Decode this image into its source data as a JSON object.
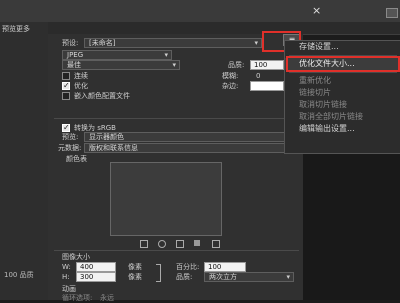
{
  "app": {
    "close_glyph": "×",
    "preview_tab": "预览更多"
  },
  "settings": {
    "preset_label": "预设:",
    "preset_value": "[未命名]",
    "format_value": "JPEG",
    "quality_level": "最佳",
    "quality_label": "品质:",
    "quality_value": "100",
    "progressive_label": "连续",
    "optimize_label": "优化",
    "embed_profile_label": "嵌入颜色配置文件",
    "blur_label": "模糊:",
    "blur_value": "0",
    "matte_label": "杂边:",
    "convert_srgb_label": "转换为 sRGB",
    "preview_label": "预览:",
    "preview_value": "显示器颜色",
    "metadata_label": "元数据:",
    "metadata_value": "版权和联系信息",
    "color_table_label": "颜色表"
  },
  "menu": {
    "button_glyph": "≡",
    "items": [
      {
        "label": "存储设置...",
        "state": "normal"
      },
      {
        "label": "",
        "state": "separator"
      },
      {
        "label": "优化文件大小...",
        "state": "highlighted"
      },
      {
        "label": "",
        "state": "separator"
      },
      {
        "label": "重新优化",
        "state": "disabled"
      },
      {
        "label": "链接切片",
        "state": "disabled"
      },
      {
        "label": "取消切片链接",
        "state": "disabled"
      },
      {
        "label": "取消全部切片链接",
        "state": "disabled"
      },
      {
        "label": "编辑输出设置...",
        "state": "normal"
      }
    ]
  },
  "image_size": {
    "header": "图像大小",
    "width_label": "W:",
    "width_value": "400",
    "height_label": "H:",
    "height_value": "300",
    "unit": "像素",
    "percent_label": "百分比:",
    "percent_value": "100",
    "quality_label": "品质:",
    "resample_value": "两次立方"
  },
  "animation": {
    "header": "动画",
    "loop_label": "循环选项:",
    "loop_value": "永远"
  },
  "left_panel": {
    "status": "100 品质"
  },
  "color_table_icons": [
    "map-icon",
    "web-icon",
    "lock-icon",
    "new-icon",
    "delete-icon"
  ],
  "colors": {
    "highlight_box": "#e0302a",
    "panel_bg": "#303030",
    "menu_bg": "#2c2c2c"
  }
}
